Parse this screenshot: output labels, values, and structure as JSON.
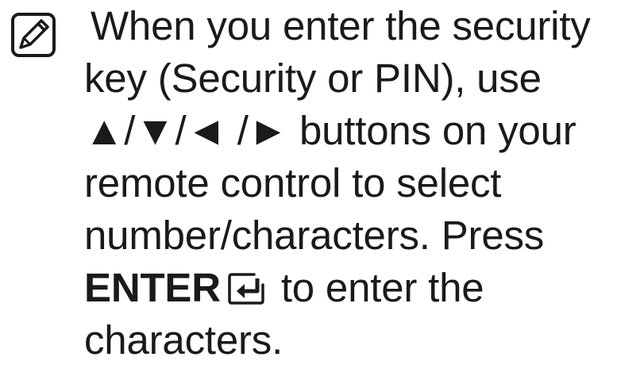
{
  "note": {
    "icon": "note-pencil-icon",
    "line1": "When you enter the security",
    "line2": "key (Security or PIN), use",
    "line3": "▲/▼/◄ /► buttons on your",
    "line4": "remote control to select",
    "line5": "number/characters. Press",
    "enter_key": "ENTER",
    "enter_icon": "enter-key-icon",
    "line6_rest": " to enter the",
    "line7": "characters."
  }
}
